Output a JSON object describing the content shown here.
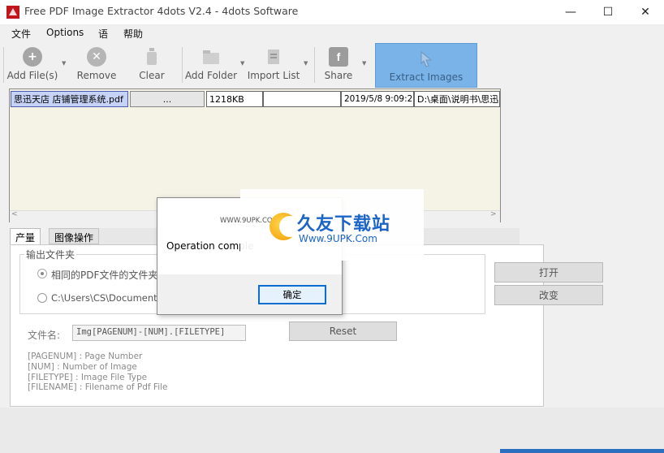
{
  "window": {
    "title": "Free PDF Image Extractor 4dots V2.4 - 4dots Software",
    "min_glyph": "—",
    "max_glyph": "☐",
    "close_glyph": "✕"
  },
  "menu": {
    "items": [
      "文件",
      "Options",
      "语",
      "帮助"
    ]
  },
  "toolbar": {
    "add_files": "Add File(s)",
    "remove": "Remove",
    "clear": "Clear",
    "add_folder": "Add Folder",
    "import_list": "Import List",
    "share": "Share",
    "extract_images": "Extract Images"
  },
  "grid": {
    "rows": [
      {
        "name": "思迅天店 店铺管理系统.pdf",
        "button": "...",
        "size": "1218KB",
        "pages": "",
        "date": "2019/5/8 9:09:23",
        "path": "D:\\桌面\\说明书\\思迅"
      }
    ]
  },
  "tabs": [
    "产量",
    "图像操作"
  ],
  "output": {
    "group_label": "输出文件夹",
    "same_folder": "相同的PDF文件的文件夹",
    "custom_folder": "C:\\Users\\CS\\Documents\\4dots",
    "open_button": "打开",
    "change_button": "改变"
  },
  "filename": {
    "label": "文件名:",
    "value": "Img[PAGENUM]-[NUM].[FILETYPE]",
    "reset_button": "Reset"
  },
  "hints": [
    "[PAGENUM] : Page Number",
    "[NUM] : Number of Image",
    "[FILETYPE] : Image File Type",
    "[FILENAME] : Filename of Pdf File"
  ],
  "dialog": {
    "message": "Operation comple",
    "ok_button": "确定"
  },
  "watermark": {
    "text": "久友下载站",
    "url": "Www.9UPK.Com",
    "small": "WWW.9UPK.COM"
  },
  "colors": {
    "accent": "#7ab3e8",
    "selected_cell": "#c6d3f7",
    "grid_bg": "#f5f2e6",
    "dialog_button_border": "#0a6ed1"
  }
}
